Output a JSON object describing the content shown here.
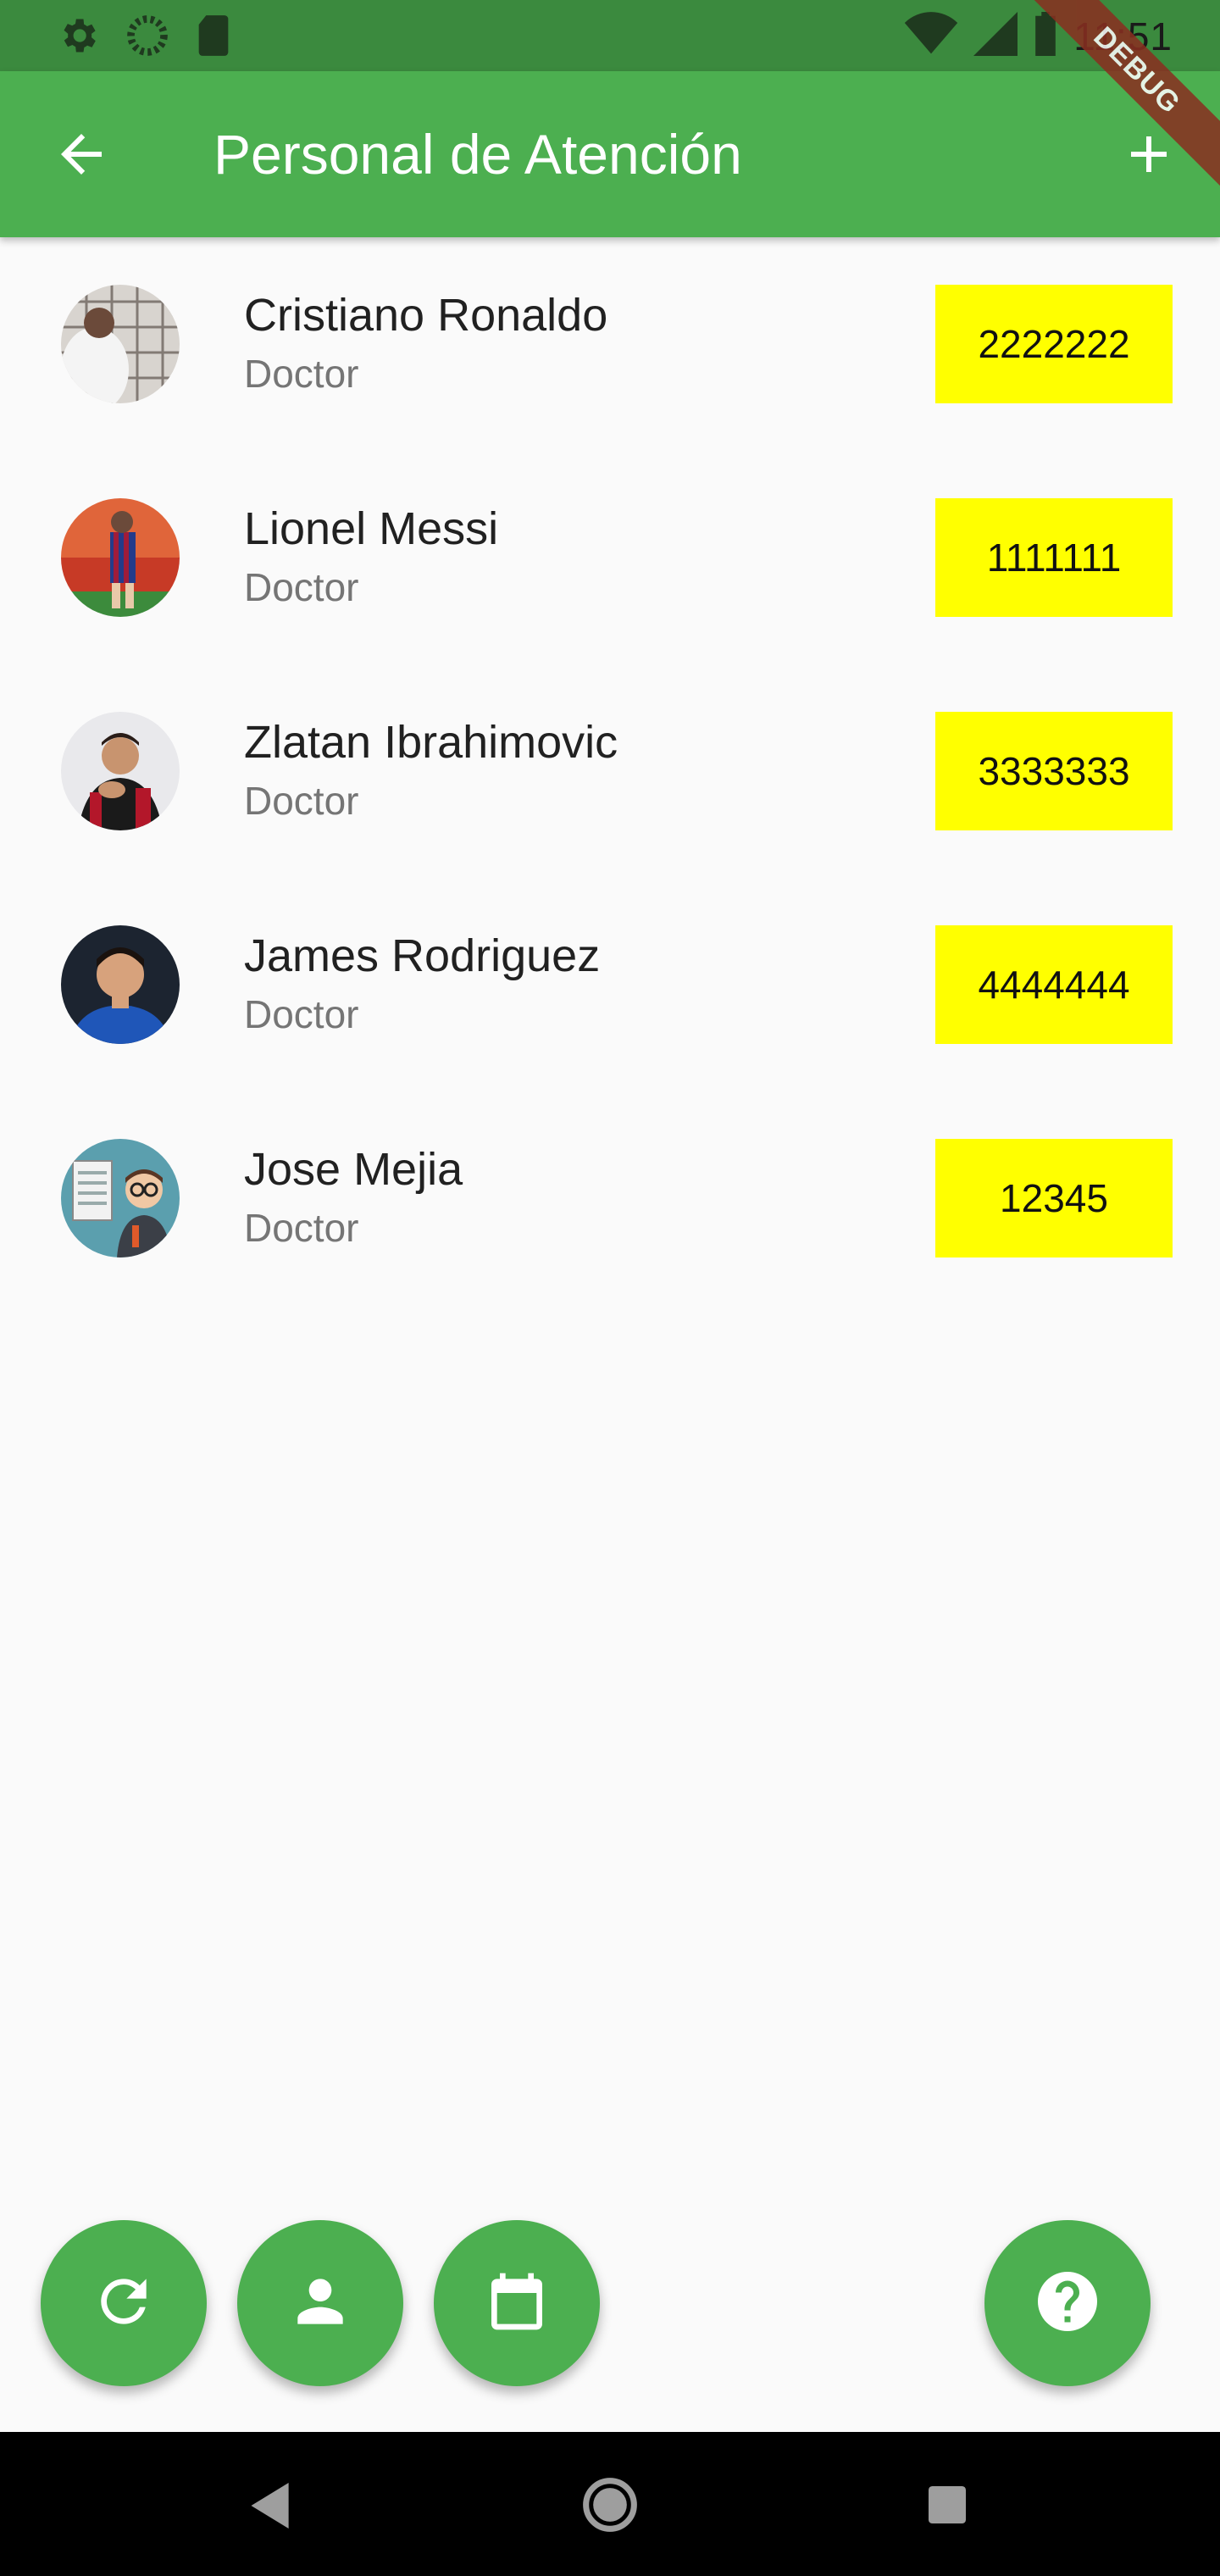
{
  "status_bar": {
    "time": "11:51",
    "left_icons": [
      "gear-icon",
      "circle-loader-icon",
      "sd-card-icon"
    ],
    "right_icons": [
      "wifi-icon",
      "signal-icon",
      "battery-icon"
    ]
  },
  "debug_banner": "DEBUG",
  "app_bar": {
    "title": "Personal de Atención",
    "back_icon": "arrow-back-icon",
    "add_icon": "add-icon",
    "color": "#4caf50"
  },
  "staff": [
    {
      "name": "Cristiano Ronaldo",
      "role": "Doctor",
      "phone": "2222222"
    },
    {
      "name": "Lionel Messi",
      "role": "Doctor",
      "phone": "1111111"
    },
    {
      "name": "Zlatan Ibrahimovic",
      "role": "Doctor",
      "phone": "3333333"
    },
    {
      "name": "James Rodriguez",
      "role": "Doctor",
      "phone": "4444444"
    },
    {
      "name": "Jose Mejia",
      "role": "Doctor",
      "phone": "12345"
    }
  ],
  "fabs": [
    {
      "icon": "refresh-icon"
    },
    {
      "icon": "person-icon"
    },
    {
      "icon": "calendar-icon"
    },
    {
      "icon": "help-icon"
    }
  ],
  "nav_bar": {
    "icons": [
      "back-triangle-icon",
      "home-circle-icon",
      "recents-square-icon"
    ]
  },
  "colors": {
    "accent": "#4caf50",
    "phone_badge": "#ffff00",
    "status_bar": "#3b8a3e"
  }
}
